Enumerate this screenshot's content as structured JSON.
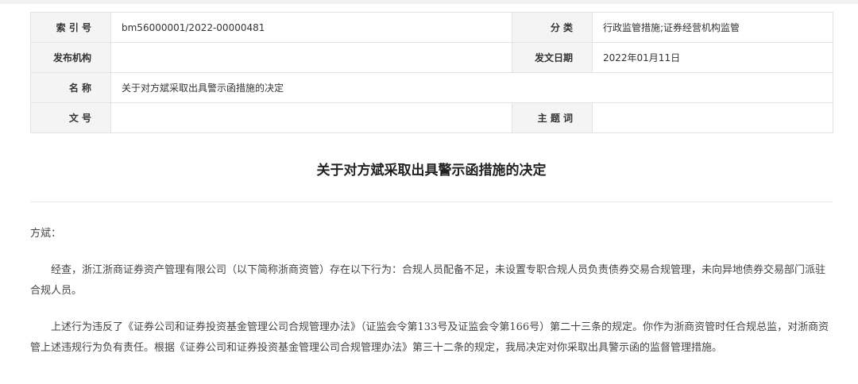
{
  "metadata": {
    "index_label": "索 引 号",
    "index_value": "bm56000001/2022-00000481",
    "category_label": "分      类",
    "category_value": "行政监管措施;证券经营机构监管",
    "issuer_label": "发布机构",
    "issuer_value": "",
    "date_label": "发文日期",
    "date_value": "2022年01月11日",
    "name_label": "名      称",
    "name_value": "关于对方斌采取出具警示函措施的决定",
    "docno_label": "文      号",
    "docno_value": "",
    "subject_label": "主 题 词",
    "subject_value": ""
  },
  "document": {
    "title": "关于对方斌采取出具警示函措施的决定",
    "salutation": "方斌：",
    "paragraphs": [
      "经查，浙江浙商证券资产管理有限公司（以下简称浙商资管）存在以下行为：合规人员配备不足，未设置专职合规人员负责债券交易合规管理，未向异地债券交易部门派驻合规人员。",
      "上述行为违反了《证券公司和证券投资基金管理公司合规管理办法》（证监会令第133号及证监会令第166号）第二十三条的规定。你作为浙商资管时任合规总监，对浙商资管上述违规行为负有责任。根据《证券公司和证券投资基金管理公司合规管理办法》第三十二条的规定，我局决定对你采取出具警示函的监督管理措施。"
    ]
  }
}
